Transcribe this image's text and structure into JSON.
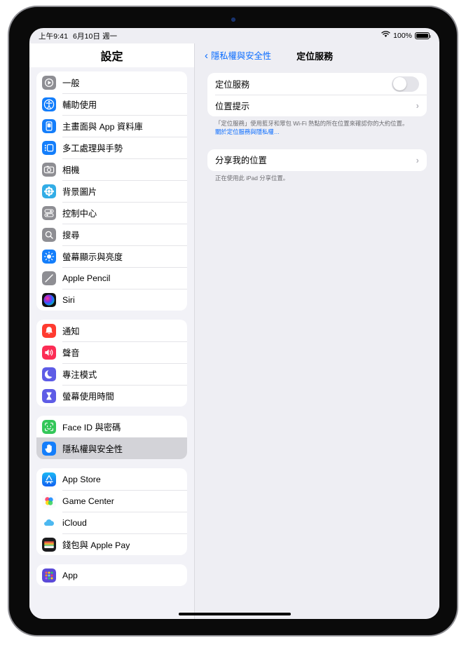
{
  "status_bar": {
    "time": "上午9:41",
    "date": "6月10日 週一",
    "wifi_icon": "wifi-icon",
    "battery_percent": "100%",
    "battery_icon": "battery-full-icon"
  },
  "sidebar": {
    "title": "設定",
    "groups": [
      {
        "items": [
          {
            "label": "一般",
            "icon": "gear-icon",
            "selected": false
          },
          {
            "label": "輔助使用",
            "icon": "accessibility-icon",
            "selected": false
          },
          {
            "label": "主畫面與 App 資料庫",
            "icon": "home-screen-icon",
            "selected": false
          },
          {
            "label": "多工處理與手勢",
            "icon": "multitasking-icon",
            "selected": false
          },
          {
            "label": "相機",
            "icon": "camera-icon",
            "selected": false
          },
          {
            "label": "背景圖片",
            "icon": "wallpaper-icon",
            "selected": false
          },
          {
            "label": "控制中心",
            "icon": "control-center-icon",
            "selected": false
          },
          {
            "label": "搜尋",
            "icon": "search-icon",
            "selected": false
          },
          {
            "label": "螢幕顯示與亮度",
            "icon": "brightness-icon",
            "selected": false
          },
          {
            "label": "Apple Pencil",
            "icon": "pencil-icon",
            "selected": false
          },
          {
            "label": "Siri",
            "icon": "siri-icon",
            "selected": false
          }
        ]
      },
      {
        "items": [
          {
            "label": "通知",
            "icon": "notifications-bell-icon",
            "selected": false
          },
          {
            "label": "聲音",
            "icon": "sound-speaker-icon",
            "selected": false
          },
          {
            "label": "專注模式",
            "icon": "focus-moon-icon",
            "selected": false
          },
          {
            "label": "螢幕使用時間",
            "icon": "screen-time-hourglass-icon",
            "selected": false
          }
        ]
      },
      {
        "items": [
          {
            "label": "Face ID 與密碼",
            "icon": "face-id-icon",
            "selected": false
          },
          {
            "label": "隱私權與安全性",
            "icon": "privacy-hand-icon",
            "selected": true
          }
        ]
      },
      {
        "items": [
          {
            "label": "App Store",
            "icon": "app-store-icon",
            "selected": false
          },
          {
            "label": "Game Center",
            "icon": "game-center-icon",
            "selected": false
          },
          {
            "label": "iCloud",
            "icon": "icloud-icon",
            "selected": false
          },
          {
            "label": "錢包與 Apple Pay",
            "icon": "wallet-icon",
            "selected": false
          }
        ]
      },
      {
        "items": [
          {
            "label": "App",
            "icon": "apps-grid-icon",
            "selected": false
          }
        ]
      }
    ]
  },
  "detail": {
    "back_label": "隱私權與安全性",
    "back_icon": "chevron-left-icon",
    "title": "定位服務",
    "card1": {
      "location_services_label": "定位服務",
      "location_services_toggle": "off",
      "location_alerts_label": "位置提示",
      "disclosure_icon": "chevron-right-icon"
    },
    "footnote1_text": "「定位服務」使用藍牙和眾包 Wi-Fi 熱點的所在位置來確認你的大約位置。",
    "footnote1_link": "關於定位服務與隱私權…",
    "card2": {
      "share_location_label": "分享我的位置",
      "disclosure_icon": "chevron-right-icon"
    },
    "footnote2_text": "正在使用此 iPad 分享位置。"
  },
  "colors": {
    "accent_blue": "#0a6cff",
    "sidebar_bg": "#f2f2f7",
    "detail_bg": "#eeeef3",
    "card_bg": "#ffffff",
    "selected_row": "#d3d3d8"
  },
  "home_indicator": "home-indicator"
}
